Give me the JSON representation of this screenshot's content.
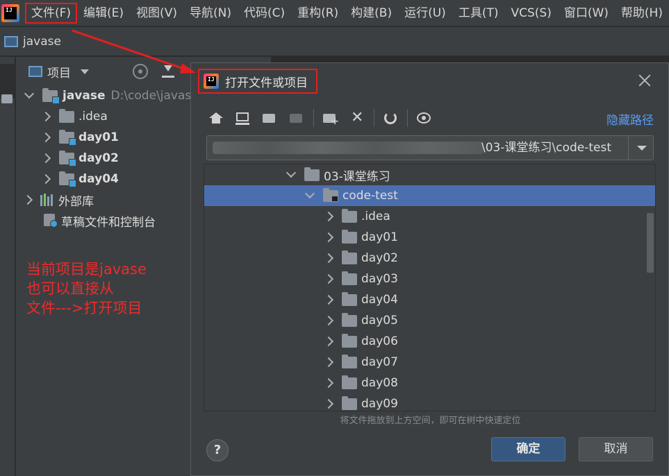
{
  "menu": [
    "文件(F)",
    "编辑(E)",
    "视图(V)",
    "导航(N)",
    "代码(C)",
    "重构(R)",
    "构建(B)",
    "运行(U)",
    "工具(T)",
    "VCS(S)",
    "窗口(W)",
    "帮助(H)"
  ],
  "navbar": {
    "project": "javase"
  },
  "project_panel": {
    "title": "项目",
    "root": {
      "name": "javase",
      "path": "D:\\code\\javase"
    },
    "children": [
      ".idea",
      "day01",
      "day02",
      "day04"
    ],
    "external_libs": "外部库",
    "scratches": "草稿文件和控制台"
  },
  "annotation": [
    "当前项目是javase",
    "也可以直接从",
    "文件--->打开项目"
  ],
  "dialog": {
    "title": "打开文件或项目",
    "hide_path": "隐藏路径",
    "path_visible": "\\03-课堂练习\\code-test",
    "tree": {
      "parent": "03-课堂练习",
      "selected": "code-test",
      "children": [
        ".idea",
        "day01",
        "day02",
        "day03",
        "day04",
        "day05",
        "day06",
        "day07",
        "day08",
        "day09"
      ]
    },
    "hint": "将文件拖放到上方空间，即可在树中快速定位",
    "help": "?",
    "ok": "确定",
    "cancel": "取消"
  },
  "colors": {
    "selection": "#4b6eaf",
    "annotation": "#ee2b2b",
    "link": "#589df6"
  }
}
